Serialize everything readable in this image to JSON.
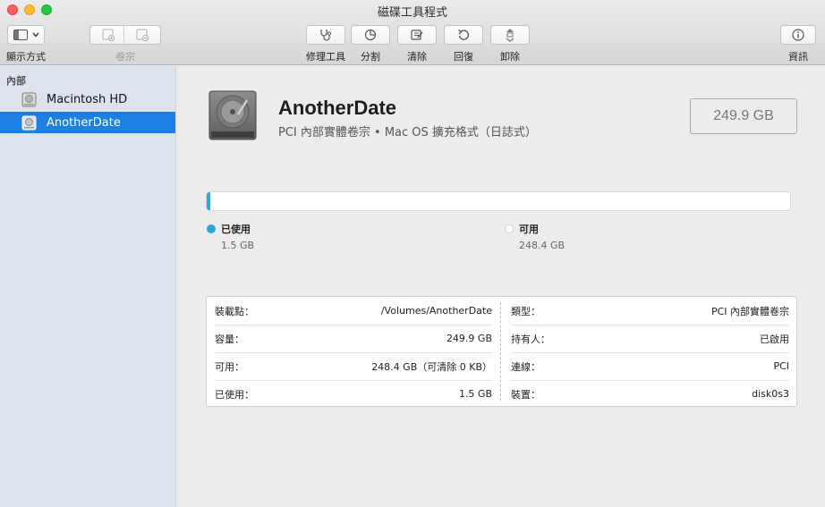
{
  "window": {
    "title": "磁碟工具程式"
  },
  "toolbar": {
    "view_label": "顯示方式",
    "volume_label": "卷宗",
    "first_aid_label": "修理工具",
    "partition_label": "分割",
    "erase_label": "清除",
    "restore_label": "回復",
    "unmount_label": "卸除",
    "info_label": "資訊",
    "icons": [
      "sidebar-icon",
      "chevron-down-icon",
      "add-volume-icon",
      "remove-volume-icon",
      "stethoscope-icon",
      "pie-chart-icon",
      "erase-icon",
      "restore-icon",
      "unmount-icon",
      "info-icon"
    ]
  },
  "sidebar": {
    "section": "內部",
    "items": [
      {
        "label": "Macintosh HD",
        "selected": false
      },
      {
        "label": "AnotherDate",
        "selected": true
      }
    ]
  },
  "volume": {
    "name": "AnotherDate",
    "subtitle": "PCI 內部實體卷宗 • Mac OS 擴充格式（日誌式）",
    "capacity": "249.9 GB"
  },
  "usage": {
    "used_fraction": 0.006,
    "used_label": "已使用",
    "used_value": "1.5 GB",
    "free_label": "可用",
    "free_value": "248.4 GB",
    "used_color": "#2fa4d8"
  },
  "info": {
    "left": [
      {
        "key": "裝載點：",
        "value": "/Volumes/AnotherDate"
      },
      {
        "key": "容量：",
        "value": "249.9 GB"
      },
      {
        "key": "可用：",
        "value": "248.4 GB（可清除 0 KB）"
      },
      {
        "key": "已使用：",
        "value": "1.5 GB"
      }
    ],
    "right": [
      {
        "key": "類型：",
        "value": "PCI 內部實體卷宗"
      },
      {
        "key": "持有人：",
        "value": "已啟用"
      },
      {
        "key": "連線：",
        "value": "PCI"
      },
      {
        "key": "裝置：",
        "value": "disk0s3"
      }
    ]
  },
  "colors": {
    "selection": "#1b7fe4",
    "sidebar_bg": "#dde3ee"
  }
}
